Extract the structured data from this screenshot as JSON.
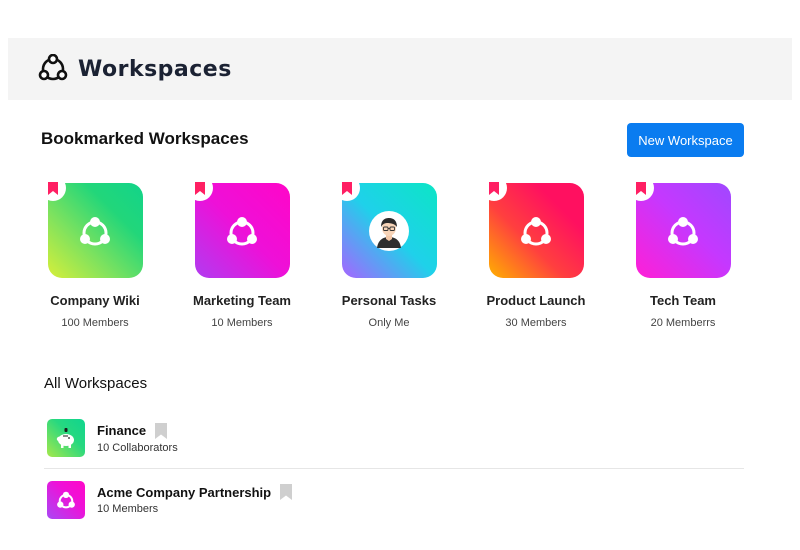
{
  "header": {
    "title": "Workspaces",
    "logo_icon": "workspace-logo-icon"
  },
  "bookmarked": {
    "title": "Bookmarked Workspaces",
    "new_button_label": "New Workspace",
    "items": [
      {
        "name": "Company Wiki",
        "sub": "100 Members",
        "icon": "workspace-hub-icon"
      },
      {
        "name": "Marketing Team",
        "sub": "10 Members",
        "icon": "workspace-hub-icon"
      },
      {
        "name": "Personal Tasks",
        "sub": "Only Me",
        "icon": "user-avatar-icon"
      },
      {
        "name": "Product Launch",
        "sub": "30 Members",
        "icon": "workspace-hub-icon"
      },
      {
        "name": "Tech Team",
        "sub": "20 Memberrs",
        "icon": "workspace-hub-icon"
      }
    ]
  },
  "all": {
    "title": "All Workspaces",
    "items": [
      {
        "name": "Finance",
        "sub": "10 Collaborators",
        "icon": "piggy-bank-icon",
        "bookmarked": false
      },
      {
        "name": "Acme Company Partnership",
        "sub": "10 Members",
        "icon": "workspace-hub-icon",
        "bookmarked": false
      }
    ]
  },
  "colors": {
    "accent": "#0a7cf0",
    "ribbon": "#ff1f63",
    "header_bg": "#f4f4f4",
    "title_color": "#1b2233"
  }
}
